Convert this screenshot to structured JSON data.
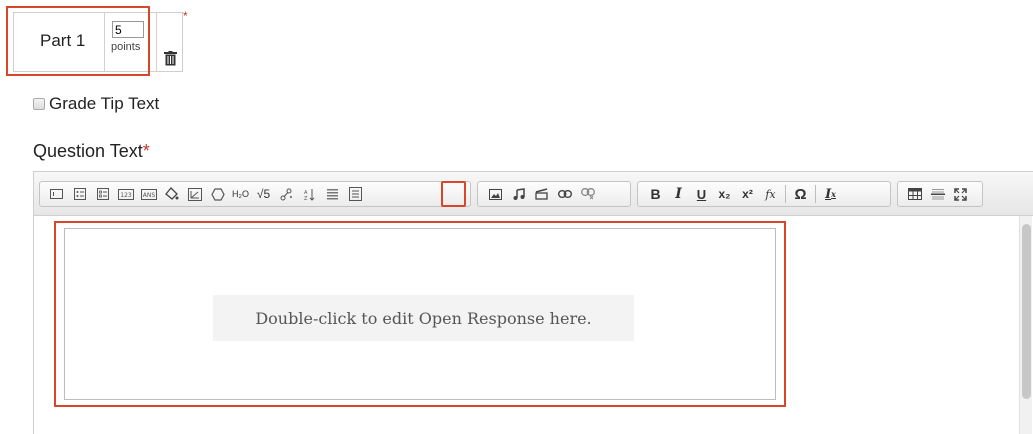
{
  "part": {
    "label": "Part 1",
    "points_value": "5",
    "points_label": "points",
    "required_marker": "*"
  },
  "grade_tip": {
    "label": "Grade Tip Text",
    "checked": false
  },
  "question": {
    "title": "Question Text",
    "required_marker": "*"
  },
  "toolbar": {
    "groups": [
      {
        "name": "widgets",
        "buttons": [
          {
            "icon": "text-input-icon"
          },
          {
            "icon": "multiple-choice-icon"
          },
          {
            "icon": "checkbox-list-icon"
          },
          {
            "icon": "numeric-input-icon",
            "text": "123"
          },
          {
            "icon": "answer-input-icon",
            "text": "ANS"
          },
          {
            "icon": "paint-bucket-icon"
          },
          {
            "icon": "graph-icon"
          },
          {
            "icon": "shape-icon"
          },
          {
            "icon": "chemistry-icon",
            "text": "H₂O"
          },
          {
            "icon": "square-root-icon",
            "text": "√5"
          },
          {
            "icon": "molecule-icon"
          },
          {
            "icon": "sort-icon"
          },
          {
            "icon": "stack-icon"
          },
          {
            "icon": "open-response-icon"
          }
        ]
      },
      {
        "name": "media",
        "buttons": [
          {
            "icon": "image-icon"
          },
          {
            "icon": "audio-icon"
          },
          {
            "icon": "video-icon"
          },
          {
            "icon": "link-icon"
          },
          {
            "icon": "unlink-icon"
          }
        ]
      },
      {
        "name": "formatting",
        "buttons": [
          {
            "icon": "bold-icon",
            "text": "B"
          },
          {
            "icon": "italic-icon",
            "text": "I"
          },
          {
            "icon": "underline-icon",
            "text": "U"
          },
          {
            "icon": "subscript-icon",
            "text": "x₂"
          },
          {
            "icon": "superscript-icon",
            "text": "x²"
          },
          {
            "icon": "formula-icon",
            "text": "fx"
          },
          {
            "icon": "special-character-icon",
            "text": "Ω"
          },
          {
            "icon": "clear-formatting-icon",
            "text": "Ix"
          }
        ]
      },
      {
        "name": "layout",
        "buttons": [
          {
            "icon": "table-icon"
          },
          {
            "icon": "horizontal-rule-icon"
          },
          {
            "icon": "fullscreen-icon"
          }
        ]
      }
    ]
  },
  "editor": {
    "widget_prompt": "Double-click to edit Open Response here."
  },
  "colors": {
    "highlight": "#d9472b",
    "required": "#c0392b"
  }
}
